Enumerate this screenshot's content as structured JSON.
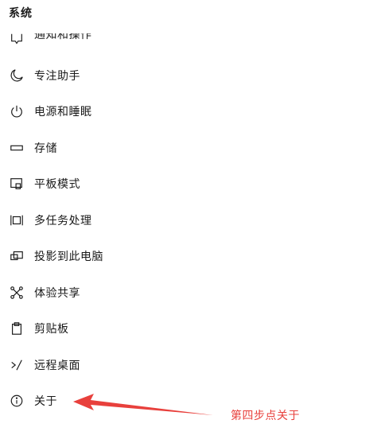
{
  "section": {
    "title": "系统"
  },
  "nav": {
    "items": [
      {
        "label": "通知和操作",
        "icon": "notification-icon"
      },
      {
        "label": "专注助手",
        "icon": "moon-icon"
      },
      {
        "label": "电源和睡眠",
        "icon": "power-icon"
      },
      {
        "label": "存储",
        "icon": "storage-icon"
      },
      {
        "label": "平板模式",
        "icon": "tablet-icon"
      },
      {
        "label": "多任务处理",
        "icon": "multitask-icon"
      },
      {
        "label": "投影到此电脑",
        "icon": "project-icon"
      },
      {
        "label": "体验共享",
        "icon": "share-icon"
      },
      {
        "label": "剪贴板",
        "icon": "clipboard-icon"
      },
      {
        "label": "远程桌面",
        "icon": "remote-desktop-icon"
      },
      {
        "label": "关于",
        "icon": "info-icon"
      }
    ]
  },
  "annotation": {
    "text": "第四步点关于",
    "color": "#e8403c"
  }
}
